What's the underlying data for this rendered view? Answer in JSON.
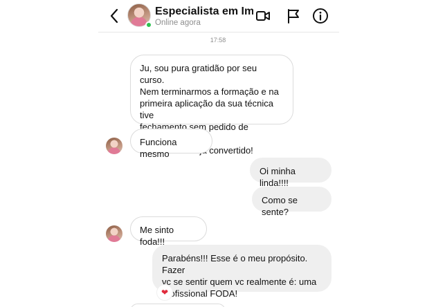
{
  "header": {
    "name": "Especialista em Im...",
    "status": "Online agora",
    "icons": [
      "back-arrow-icon",
      "video-call-icon",
      "flag-icon",
      "info-icon"
    ]
  },
  "timestamp": "17:58",
  "messages": [
    {
      "side": "incoming",
      "lines": [
        "Ju, sou pura gratidão por seu curso.",
        "Nem terminarmos a formação e na",
        "primeira aplicação da sua técnica tive",
        "fechamento sem pedido de desconto.",
        "Valor do curso já convertido!"
      ]
    },
    {
      "side": "incoming",
      "lines": [
        "Funciona mesmo"
      ]
    },
    {
      "side": "outgoing",
      "lines": [
        "Oi minha linda!!!!"
      ]
    },
    {
      "side": "outgoing",
      "lines": [
        "Como se sente?"
      ]
    },
    {
      "side": "incoming",
      "lines": [
        "Me sinto foda!!!"
      ]
    },
    {
      "side": "outgoing",
      "lines": [
        "Parabéns!!! Esse é o meu propósito. Fazer",
        "vc se sentir quem vc realmente é: uma",
        "profissional FODA!"
      ],
      "reaction": "❤"
    }
  ],
  "colors": {
    "online": "#2bc24e",
    "outgoing_bubble": "#efefef",
    "incoming_border": "#dbdbdb",
    "reaction_heart": "#e02b3c"
  }
}
